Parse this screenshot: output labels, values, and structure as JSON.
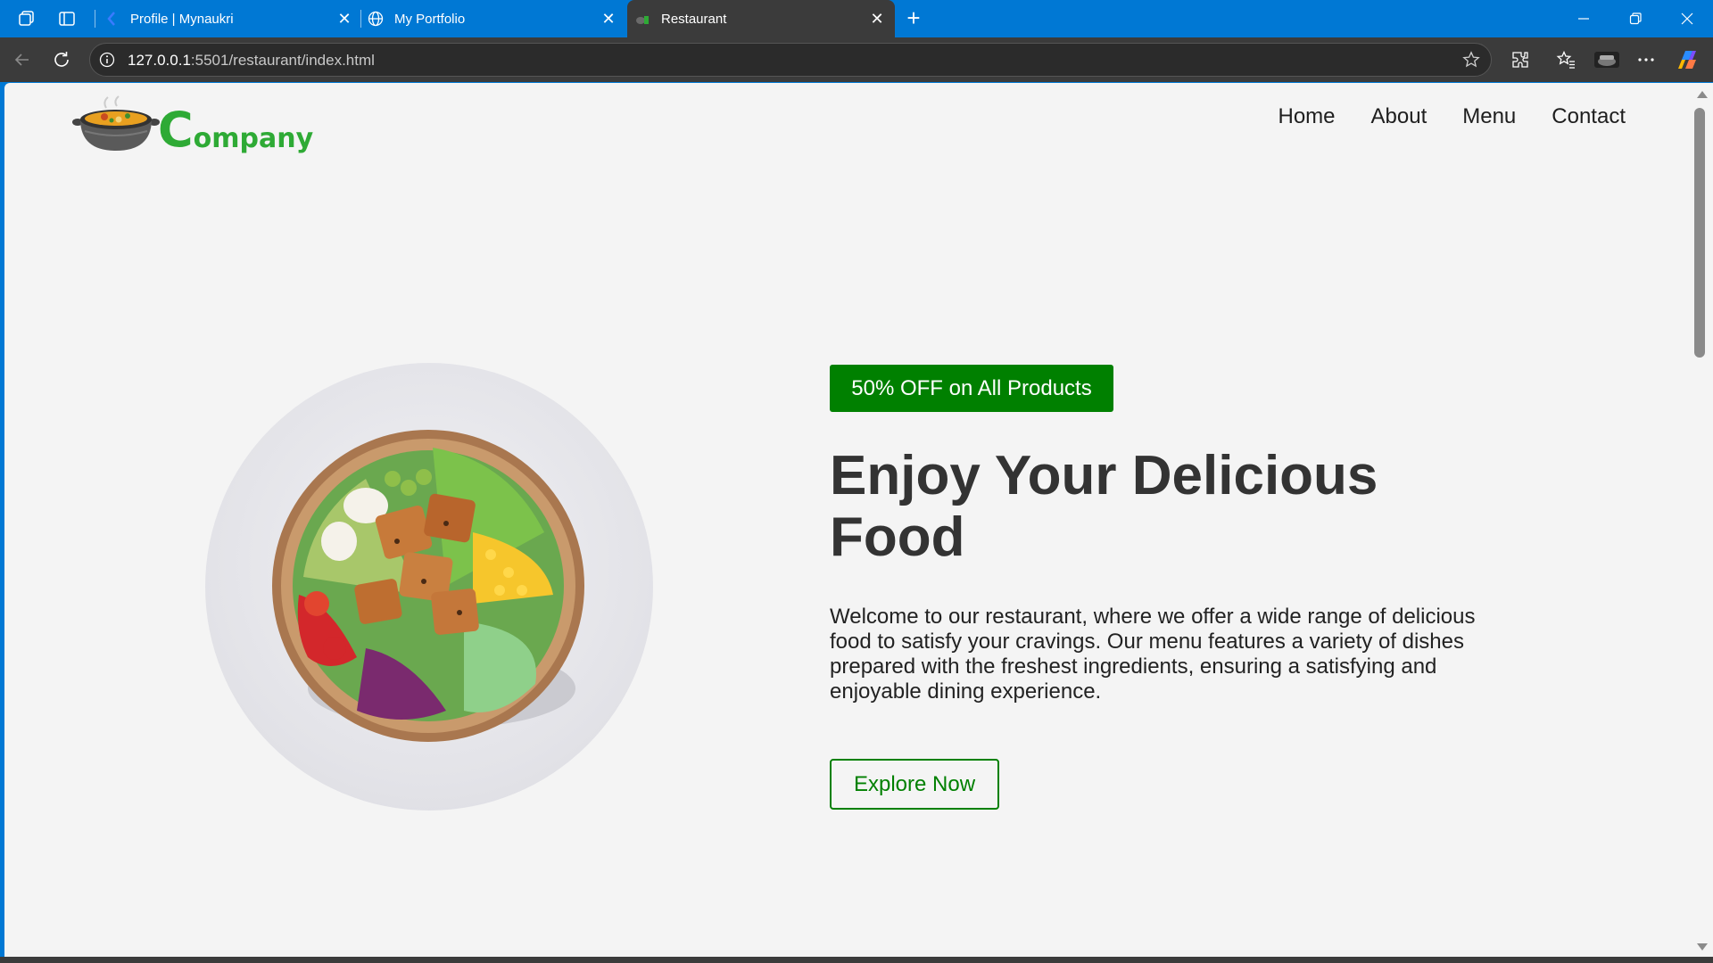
{
  "browser": {
    "tabs": [
      {
        "title": "Profile | Mynaukri",
        "favicon": "naukri-icon",
        "active": false
      },
      {
        "title": "My Portfolio",
        "favicon": "globe-icon",
        "active": false
      },
      {
        "title": "Restaurant",
        "favicon": "restaurant-favicon",
        "active": true
      }
    ],
    "url_host": "127.0.0.1",
    "url_rest": ":5501/restaurant/index.html",
    "theme": {
      "frame": "#0078d4",
      "toolbar": "#3b3b3b"
    }
  },
  "page": {
    "logo": {
      "initial": "C",
      "rest": "ompany",
      "color": "#2eaa35"
    },
    "nav": [
      "Home",
      "About",
      "Menu",
      "Contact"
    ],
    "hero": {
      "badge": "50% OFF on All Products",
      "title": "Enjoy Your Delicious Food",
      "description": "Welcome to our restaurant, where we offer a wide range of delicious food to satisfy your cravings. Our menu features a variety of dishes prepared with the freshest ingredients, ensuring a satisfying and enjoyable dining experience.",
      "cta": "Explore Now"
    },
    "colors": {
      "accent": "#008000",
      "background": "#f4f4f4",
      "heading": "#333333"
    }
  }
}
